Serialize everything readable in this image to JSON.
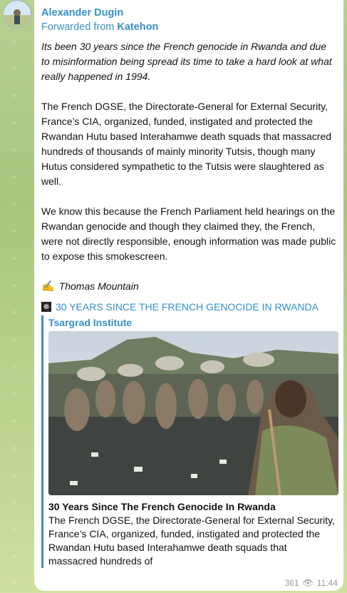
{
  "post": {
    "sender": "Alexander Dugin",
    "forwarded_prefix": "Forwarded from ",
    "forwarded_source": "Katehon",
    "paragraph1": "Its been 30 years since the French genocide in Rwanda and due to misinformation being spread its time to take a hard look at what really happened in 1994.",
    "paragraph2": "The French DGSE, the Directorate-General for External Security, France’s CIA, organized, funded, instigated and protected the Rwandan Hutu based Interahamwe death squads that massacred hundreds of thousands of mainly minority Tutsis, though many Hutus considered sympathetic to the Tutsis were slaughtered as well.",
    "paragraph3": "We know this because the French Parliament held hearings on the Rwandan genocide and though they claimed they, the French, were not directly responsible, enough information was made public to expose this smokescreen.",
    "signature_emoji": "✍️",
    "signature": "Thomas Mountain",
    "link_icon": "gear-icon",
    "link_text": "30 YEARS SINCE THE FRENCH GENOCIDE IN RWANDA"
  },
  "preview": {
    "site": "Tsargrad Institute",
    "title": "30 Years Since The French Genocide In Rwanda",
    "description": "The French DGSE, the Directorate-General for External Security, France’s CIA, organized, funded, instigated and protected the Rwandan Hutu based Interahamwe death squads that massacred hundreds of"
  },
  "meta": {
    "views": "361",
    "time": "11:44"
  },
  "colors": {
    "link": "#3390c9",
    "background": "#b7cf8f"
  }
}
